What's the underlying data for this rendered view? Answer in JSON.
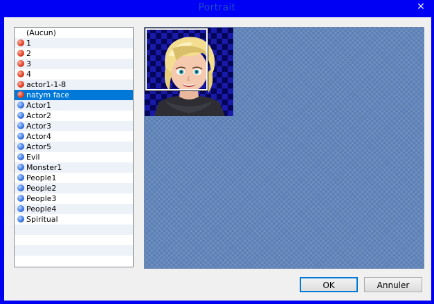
{
  "window": {
    "title": "Portrait",
    "close_glyph": "✕"
  },
  "face_list": {
    "selected_index": 6,
    "items": [
      {
        "label": "(Aucun)",
        "icon": "none"
      },
      {
        "label": "1",
        "icon": "red-dot-icon"
      },
      {
        "label": "2",
        "icon": "red-dot-icon"
      },
      {
        "label": "3",
        "icon": "red-dot-icon"
      },
      {
        "label": "4",
        "icon": "red-dot-icon"
      },
      {
        "label": "actor1-1-8",
        "icon": "red-dot-icon"
      },
      {
        "label": "natym face",
        "icon": "red-dot-icon"
      },
      {
        "label": "Actor1",
        "icon": "blue-dot-icon"
      },
      {
        "label": "Actor2",
        "icon": "blue-dot-icon"
      },
      {
        "label": "Actor3",
        "icon": "blue-dot-icon"
      },
      {
        "label": "Actor4",
        "icon": "blue-dot-icon"
      },
      {
        "label": "Actor5",
        "icon": "blue-dot-icon"
      },
      {
        "label": "Evil",
        "icon": "blue-dot-icon"
      },
      {
        "label": "Monster1",
        "icon": "blue-dot-icon"
      },
      {
        "label": "People1",
        "icon": "blue-dot-icon"
      },
      {
        "label": "People2",
        "icon": "blue-dot-icon"
      },
      {
        "label": "People3",
        "icon": "blue-dot-icon"
      },
      {
        "label": "People4",
        "icon": "blue-dot-icon"
      },
      {
        "label": "Spiritual",
        "icon": "blue-dot-icon"
      }
    ]
  },
  "colors": {
    "title_bar": "#0000f5",
    "selection": "#0078d7",
    "red_icon": "#e0442a",
    "blue_icon": "#3f7be8"
  },
  "buttons": {
    "ok_label": "OK",
    "cancel_label": "Annuler"
  }
}
